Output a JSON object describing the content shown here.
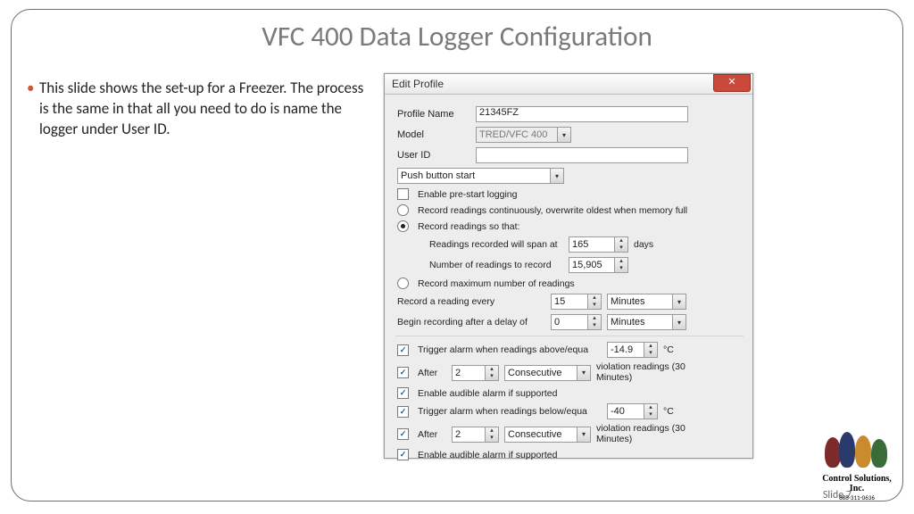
{
  "title": "VFC 400 Data Logger Configuration",
  "bullet_text": "This slide shows the set-up for a Freezer. The process is the same in that all you need to do is name the logger under User ID.",
  "footer": "Slide 7",
  "logo": {
    "name": "Control Solutions, Inc.",
    "phone": "888-311-0636"
  },
  "dialog": {
    "title": "Edit Profile",
    "labels": {
      "profile_name": "Profile Name",
      "model": "Model",
      "user_id": "User ID",
      "start_mode": "Push button start",
      "enable_prestart": "Enable pre-start logging",
      "record_continuous": "Record readings continuously, overwrite oldest when memory full",
      "record_so_that": "Record readings so that:",
      "span_at": "Readings recorded will span at",
      "days": "days",
      "num_readings": "Number of readings to record",
      "record_max": "Record maximum number of readings",
      "record_every": "Record a reading every",
      "begin_after": "Begin recording after a delay of",
      "unit_minutes": "Minutes",
      "trigger_above": "Trigger alarm when readings above/equa",
      "trigger_below": "Trigger alarm when readings below/equa",
      "deg_c": "°C",
      "after": "After",
      "consecutive": "Consecutive",
      "violation": "violation readings (30 Minutes)",
      "enable_audible": "Enable audible alarm if supported"
    },
    "values": {
      "profile_name": "21345FZ",
      "model": "TRED/VFC 400",
      "user_id": "",
      "span_days": "165",
      "num_readings": "15,905",
      "record_every": "15",
      "begin_after": "0",
      "above_temp": "-14.9",
      "below_temp": "-40",
      "after_above": "2",
      "after_below": "2"
    }
  }
}
